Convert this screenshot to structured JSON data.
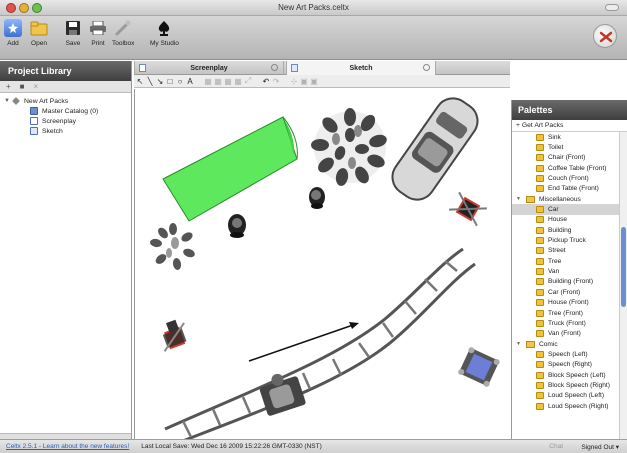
{
  "window": {
    "title": "New Art Packs.celtx"
  },
  "toolbar": {
    "items": [
      {
        "label": "Add",
        "icon": "add-icon"
      },
      {
        "label": "Open",
        "icon": "folder-icon"
      },
      {
        "label": "Save",
        "icon": "save-icon"
      },
      {
        "label": "Print",
        "icon": "print-icon"
      },
      {
        "label": "Toolbox",
        "icon": "toolbox-icon"
      },
      {
        "label": "My Studio",
        "icon": "studio-icon"
      }
    ]
  },
  "sidebar": {
    "title": "Project Library",
    "tools": [
      "+",
      "■",
      "×"
    ],
    "tree": [
      {
        "label": "New Art Packs",
        "level": 0,
        "icon": "project-icon"
      },
      {
        "label": "Master Catalog (0)",
        "level": 1,
        "icon": "catalog-icon"
      },
      {
        "label": "Screenplay",
        "level": 1,
        "icon": "screenplay-icon"
      },
      {
        "label": "Sketch",
        "level": 1,
        "icon": "sketch-icon"
      }
    ]
  },
  "tabs": [
    {
      "label": "Screenplay",
      "active": false
    },
    {
      "label": "Sketch",
      "active": true
    }
  ],
  "drawtools": [
    "↖",
    "╲",
    "↘",
    "□",
    "○",
    "A",
    "▦",
    "▦",
    "▦",
    "▦",
    "⤢",
    "↶",
    "↷",
    "⊹",
    "▣",
    "▣"
  ],
  "palettes": {
    "title": "Palettes",
    "get_art": "+ Get Art Packs",
    "items": [
      {
        "label": "Sink",
        "type": "item"
      },
      {
        "label": "Toilet",
        "type": "item"
      },
      {
        "label": "Chair (Front)",
        "type": "item"
      },
      {
        "label": "Coffee Table (Front)",
        "type": "item"
      },
      {
        "label": "Couch (Front)",
        "type": "item"
      },
      {
        "label": "End Table (Front)",
        "type": "item"
      },
      {
        "label": "Miscellaneous",
        "type": "folder"
      },
      {
        "label": "Car",
        "type": "item",
        "selected": true
      },
      {
        "label": "House",
        "type": "item"
      },
      {
        "label": "Building",
        "type": "item"
      },
      {
        "label": "Pickup Truck",
        "type": "item"
      },
      {
        "label": "Street",
        "type": "item"
      },
      {
        "label": "Tree",
        "type": "item"
      },
      {
        "label": "Van",
        "type": "item"
      },
      {
        "label": "Building (Front)",
        "type": "item"
      },
      {
        "label": "Car (Front)",
        "type": "item"
      },
      {
        "label": "House (Front)",
        "type": "item"
      },
      {
        "label": "Tree (Front)",
        "type": "item"
      },
      {
        "label": "Truck (Front)",
        "type": "item"
      },
      {
        "label": "Van (Front)",
        "type": "item"
      },
      {
        "label": "Comic",
        "type": "folder"
      },
      {
        "label": "Speech (Left)",
        "type": "item"
      },
      {
        "label": "Speech (Right)",
        "type": "item"
      },
      {
        "label": "Block Speech (Left)",
        "type": "item"
      },
      {
        "label": "Block Speech (Right)",
        "type": "item"
      },
      {
        "label": "Loud Speech (Left)",
        "type": "item"
      },
      {
        "label": "Loud Speech (Right)",
        "type": "item"
      }
    ]
  },
  "status": {
    "link": "Celtx 2.5.1 - Learn about the new features!",
    "save": "Last Local Save: Wed Dec 16 2009 15:22:26 GMT-0330 (NST)",
    "chat": "Chat",
    "signed": "Signed Out ▾"
  },
  "colors": {
    "accent": "#5ee85e",
    "link": "#2d5fb5"
  }
}
